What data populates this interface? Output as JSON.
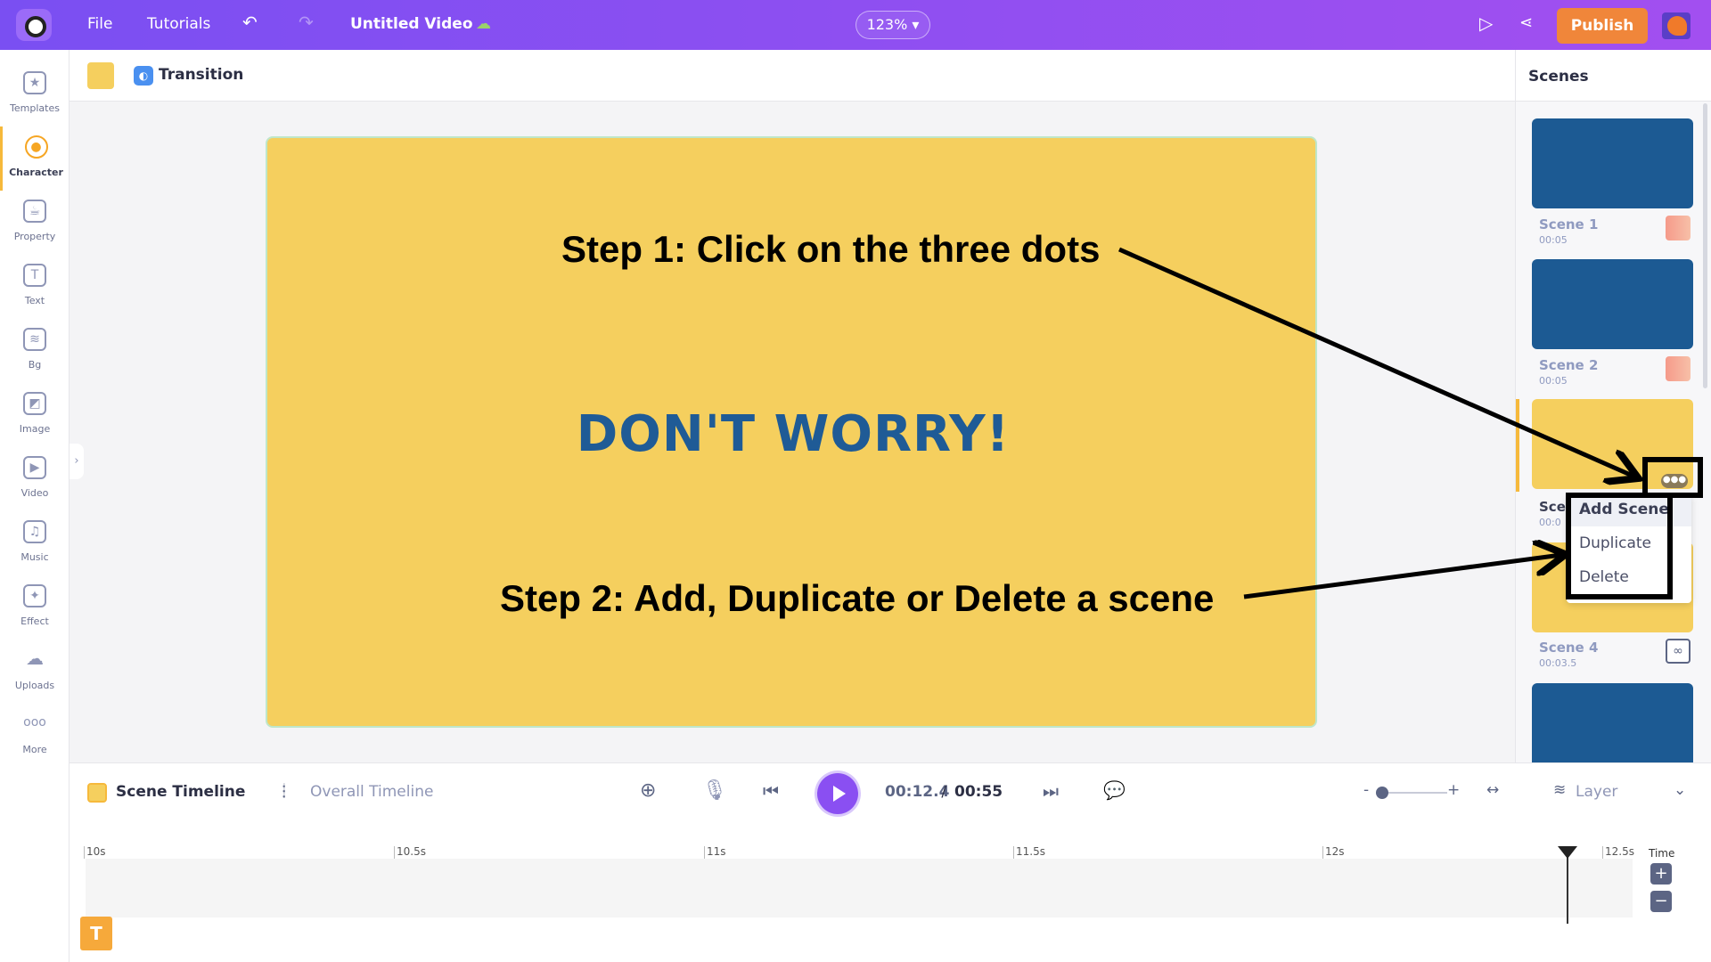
{
  "topbar": {
    "file": "File",
    "tutorials": "Tutorials",
    "title": "Untitled Video",
    "zoom": "123%",
    "publish": "Publish"
  },
  "sidebar": {
    "items": [
      {
        "label": "Templates",
        "icon": "clapper-icon"
      },
      {
        "label": "Character",
        "icon": "person-icon"
      },
      {
        "label": "Property",
        "icon": "teapot-icon"
      },
      {
        "label": "Text",
        "icon": "text-icon"
      },
      {
        "label": "Bg",
        "icon": "layers-icon"
      },
      {
        "label": "Image",
        "icon": "image-icon"
      },
      {
        "label": "Video",
        "icon": "video-icon"
      },
      {
        "label": "Music",
        "icon": "music-icon"
      },
      {
        "label": "Effect",
        "icon": "sparkle-icon"
      },
      {
        "label": "Uploads",
        "icon": "cloud-upload-icon"
      },
      {
        "label": "More",
        "icon": "more-icon"
      }
    ],
    "active": "Character"
  },
  "subbar": {
    "transition": "Transition",
    "swatch_color": "#f5cf5e"
  },
  "canvas": {
    "headline": "DON'T WORRY!",
    "step1": "Step 1: Click on the three dots",
    "step2": "Step 2: Add, Duplicate or Delete a scene",
    "bg": "#f5cf5e"
  },
  "scenes": {
    "title": "Scenes",
    "items": [
      {
        "name": "Scene 1",
        "time": "00:05",
        "color": "#1c5a93"
      },
      {
        "name": "Scene 2",
        "time": "00:05",
        "color": "#1c5a93"
      },
      {
        "name": "Sce",
        "time": "00:0",
        "color": "#f5cf5e"
      },
      {
        "name": "Scene 4",
        "time": "00:03.5",
        "color": "#f5cf5e"
      },
      {
        "name": "",
        "time": "",
        "color": "#1c5a93"
      }
    ],
    "menu": [
      "Add Scene",
      "Duplicate",
      "Delete"
    ]
  },
  "timeline": {
    "scene_tab": "Scene Timeline",
    "overall_tab": "Overall Timeline",
    "current": "00:12.4",
    "sep": " / ",
    "total": "00:55",
    "layer": "Layer",
    "time_label": "Time",
    "ticks": [
      "10s",
      "10.5s",
      "11s",
      "11.5s",
      "12s",
      "12.5s"
    ],
    "text_block": "T"
  }
}
